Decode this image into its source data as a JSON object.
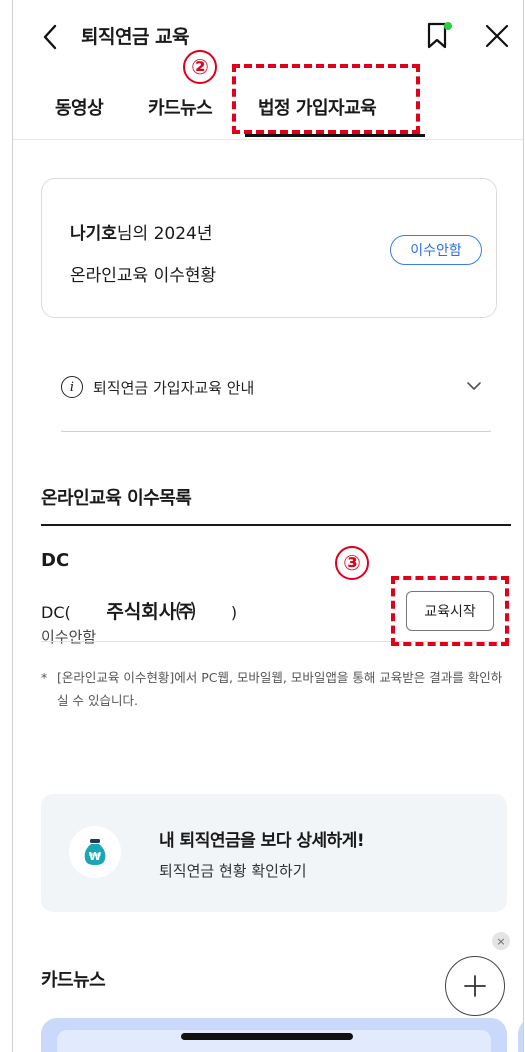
{
  "header": {
    "title": "퇴직연금 교육"
  },
  "tabs": [
    {
      "label": "동영상"
    },
    {
      "label": "카드뉴스"
    },
    {
      "label": "법정 가입자교육"
    }
  ],
  "annotations": {
    "step2": "②",
    "step3": "③"
  },
  "status_card": {
    "user_name": "나기호",
    "line1_suffix": "님의 2024년",
    "line2": "온라인교육 이수현황",
    "status_pill": "이수안함"
  },
  "info": {
    "label": "퇴직연금 가입자교육 안내",
    "icon_letter": "i"
  },
  "course_list": {
    "title": "온라인교육 이수목록",
    "items": [
      {
        "type": "DC",
        "company_prefix": "DC(",
        "company_name": "주식회사㈜",
        "company_suffix": ")",
        "status": "이수안함",
        "action": "교육시작"
      }
    ]
  },
  "notice": {
    "star": "*",
    "text": "[온라인교육 이수현황]에서 PC웹, 모바일웹, 모바일앱을 통해 교육받은 결과를 확인하실 수 있습니다."
  },
  "promo": {
    "title": "내 퇴직연금을 보다 상세하게!",
    "subtitle": "퇴직연금 현황 확인하기",
    "icon_symbol": "₩"
  },
  "card_news": {
    "title": "카드뉴스"
  },
  "fab": {
    "symbol": "+"
  },
  "small_close": {
    "symbol": "×"
  },
  "colors": {
    "accent_blue": "#2f6fe6",
    "annotation_red": "#e0001a",
    "bookmark_dot": "#2ecc40",
    "promo_bg": "#f2f5f8",
    "moneybag_teal": "#1aa6b7"
  }
}
